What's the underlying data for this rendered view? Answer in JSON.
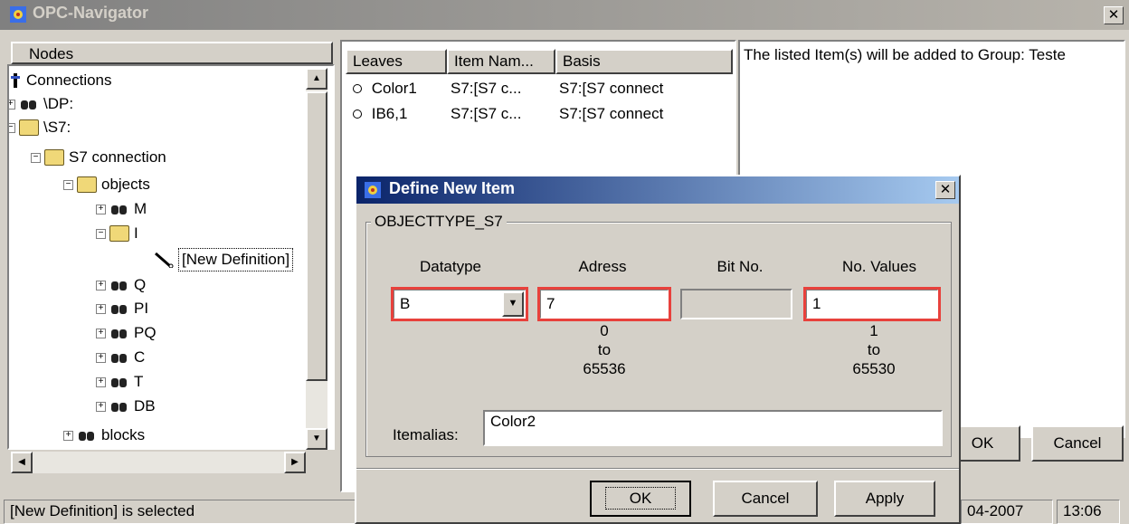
{
  "window": {
    "title": "OPC-Navigator"
  },
  "tree": {
    "header": "Nodes",
    "items": [
      {
        "label": "Connections"
      },
      {
        "label": "\\DP:"
      },
      {
        "label": "\\S7:"
      },
      {
        "label": "S7 connection"
      },
      {
        "label": "objects"
      },
      {
        "label": "M"
      },
      {
        "label": "I"
      },
      {
        "label": "[New Definition]"
      },
      {
        "label": "Q"
      },
      {
        "label": "PI"
      },
      {
        "label": "PQ"
      },
      {
        "label": "C"
      },
      {
        "label": "T"
      },
      {
        "label": "DB"
      },
      {
        "label": "blocks"
      }
    ]
  },
  "list": {
    "columns": [
      "Leaves",
      "Item Nam...",
      "Basis"
    ],
    "rows": [
      {
        "leaf": "Color1",
        "item": "S7:[S7 c...",
        "basis": "S7:[S7 connect"
      },
      {
        "leaf": "IB6,1",
        "item": "S7:[S7 c...",
        "basis": "S7:[S7 connect"
      }
    ]
  },
  "right_pane": {
    "label": "The listed Item(s) will be added to Group: Teste",
    "ok_label": "OK",
    "cancel_label": "Cancel"
  },
  "status": {
    "message": "[New Definition] is selected",
    "date": "04-2007",
    "time": "13:06"
  },
  "dialog": {
    "title": "Define New Item",
    "group_label": "OBJECTTYPE_S7",
    "columns": {
      "datatype": "Datatype",
      "adress": "Adress",
      "bitno": "Bit No.",
      "novalues": "No. Values"
    },
    "values": {
      "datatype": "B",
      "adress": "7",
      "bitno": "",
      "novalues": "1"
    },
    "ranges": {
      "adress": {
        "min": "0",
        "to": "to",
        "max": "65536"
      },
      "novalues": {
        "min": "1",
        "to": "to",
        "max": "65530"
      }
    },
    "itemalias_label": "Itemalias:",
    "itemalias_value": "Color2",
    "ok_label": "OK",
    "cancel_label": "Cancel",
    "apply_label": "Apply"
  }
}
